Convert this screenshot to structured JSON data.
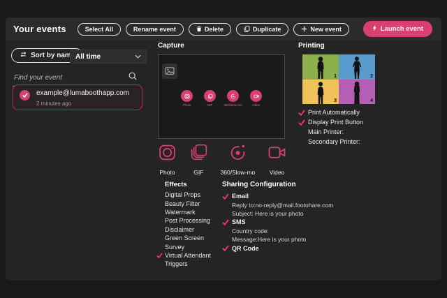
{
  "app": {
    "title": "Your events"
  },
  "toolbar": {
    "select_all": "Select All",
    "rename": "Rename event",
    "delete": "Delete",
    "duplicate": "Duplicate",
    "new_event": "New event",
    "launch": "Launch event"
  },
  "sidebar": {
    "sort_label": "Sort by name",
    "time_filter": "All time",
    "search_placeholder": "Find your event",
    "event": {
      "name": "example@lumaboothapp.com",
      "time": "2 minutes ago"
    }
  },
  "capture": {
    "heading": "Capture",
    "modes": [
      {
        "label": "Photo"
      },
      {
        "label": "GIF"
      },
      {
        "label": "360/Slow-mo"
      },
      {
        "label": "Video"
      }
    ]
  },
  "effects": {
    "heading": "Effects",
    "items": [
      {
        "label": "Digital Props",
        "checked": false
      },
      {
        "label": "Beauty Filter",
        "checked": false
      },
      {
        "label": "Watermark",
        "checked": false
      },
      {
        "label": "Post Processing",
        "checked": false
      },
      {
        "label": "Disclaimer",
        "checked": false
      },
      {
        "label": "Green Screen",
        "checked": false
      },
      {
        "label": "Survey",
        "checked": false
      },
      {
        "label": "Virtual Attendant",
        "checked": true
      },
      {
        "label": "Triggers",
        "checked": false
      }
    ]
  },
  "sharing": {
    "heading": "Sharing Configuration",
    "email": {
      "label": "Email",
      "checked": true,
      "reply_to_label": "Reply to:",
      "reply_to": "no-reply@mail.footohare.com",
      "subject_label": "Subject:",
      "subject": "Here is your photo"
    },
    "sms": {
      "label": "SMS",
      "checked": true,
      "country_label": "Country code:",
      "message_label": "Message:",
      "message": "Here is your photo"
    },
    "qr": {
      "label": "QR Code",
      "checked": true
    }
  },
  "printing": {
    "heading": "Printing",
    "cells": [
      {
        "num": "1",
        "color": "#8cb14c"
      },
      {
        "num": "2",
        "color": "#5a9bcd"
      },
      {
        "num": "3",
        "color": "#f0c35a"
      },
      {
        "num": "4",
        "color": "#b45fb4"
      }
    ],
    "options": {
      "auto": "Print Automatically",
      "auto_checked": true,
      "display": "Display Print Button",
      "display_checked": true,
      "main": "Main Printer:",
      "secondary": "Secondary Printer:"
    }
  },
  "colors": {
    "accent": "#d8416f",
    "check": "#e5366e"
  }
}
